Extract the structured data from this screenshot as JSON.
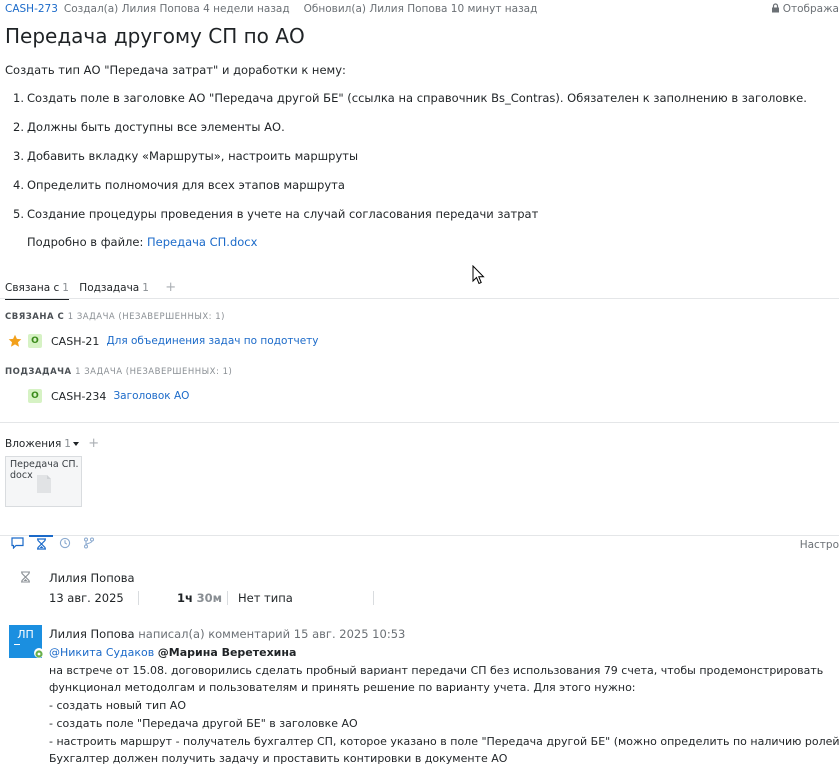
{
  "header": {
    "issue_id": "CASH-273",
    "created": "Создал(а) Лилия Попова 4 недели назад",
    "updated": "Обновил(а) Лилия Попова 10 минут назад",
    "visibility": "Отобража"
  },
  "title": "Передача другому СП по АО",
  "description": {
    "intro": "Создать тип АО \"Передача затрат\" и доработки к нему:",
    "steps": [
      {
        "num": "1.",
        "text": "Создать поле в заголовке АО \"Передача другой БЕ\" (ссылка на справочник Bs_Contras). Обязателен к заполнению в заголовке."
      },
      {
        "num": "2.",
        "text": "Должны быть доступны все элементы АО."
      },
      {
        "num": "3.",
        "text": "Добавить вкладку «Маршруты», настроить маршруты"
      },
      {
        "num": "4.",
        "text": "Определить полномочия для всех этапов маршрута"
      },
      {
        "num": "5.",
        "text": "Создание процедуры проведения в учете на случай согласования передачи затрат"
      }
    ],
    "file_prefix": "Подробно в файле: ",
    "file_link": "Передача СП.docx"
  },
  "link_tabs": [
    {
      "label": "Связана с",
      "count": "1"
    },
    {
      "label": "Подзадача",
      "count": "1"
    }
  ],
  "link_tabs_add": "+",
  "groups": [
    {
      "title": "СВЯЗАНА С",
      "sub": "1 ЗАДАЧА (НЕЗАВЕРШЕННЫХ: 1)",
      "item": {
        "state": "О",
        "id": "CASH-21",
        "summary": "Для объединения задач по подотчету",
        "starred": true
      }
    },
    {
      "title": "ПОДЗАДАЧА",
      "sub": "1 ЗАДАЧА (НЕЗАВЕРШЕННЫХ: 1)",
      "item": {
        "state": "О",
        "id": "CASH-234",
        "summary": "Заголовок АО",
        "starred": false
      }
    }
  ],
  "attachments": {
    "label": "Вложения",
    "count": "1",
    "add": "+",
    "file_name": "Передача СП. docx"
  },
  "activity": {
    "settings": "Настро"
  },
  "work_item": {
    "author": "Лилия Попова",
    "date": "13 авг. 2025",
    "hours": "1ч",
    "minutes": "30м",
    "type": "Нет типа"
  },
  "comment": {
    "avatar": "ЛП",
    "author": "Лилия Попова",
    "verb": "написал(а) комментарий",
    "time": "15 авг. 2025 10:53",
    "mention1": "@Никита Судаков",
    "mention2": "@Марина Веретехина",
    "lines": [
      "на встрече от 15.08. договорились сделать пробный вариант передачи СП без использования 79 счета, чтобы продемонстрировать",
      "функционал методолгам и пользователям и принять решение по варианту учета. Для этого нужно:",
      "- создать новый тип АО",
      "- создать поле \"Передача другой БЕ\" в заголовке АО",
      "- настроить маршрут - получатель бухгалтер СП, которое указано в поле \"Передача другой БЕ\" (можно определить по наличию ролей с СП).",
      "Бухгалтер должен получить задачу и проставить контировки в документе АО"
    ]
  },
  "colors": {
    "accent": "#1b6ac9",
    "avatar": "#1b8fe0",
    "star": "#f2a01b",
    "state_badge_bg": "#d6f2c4",
    "state_badge_fg": "#3a8a1a"
  }
}
